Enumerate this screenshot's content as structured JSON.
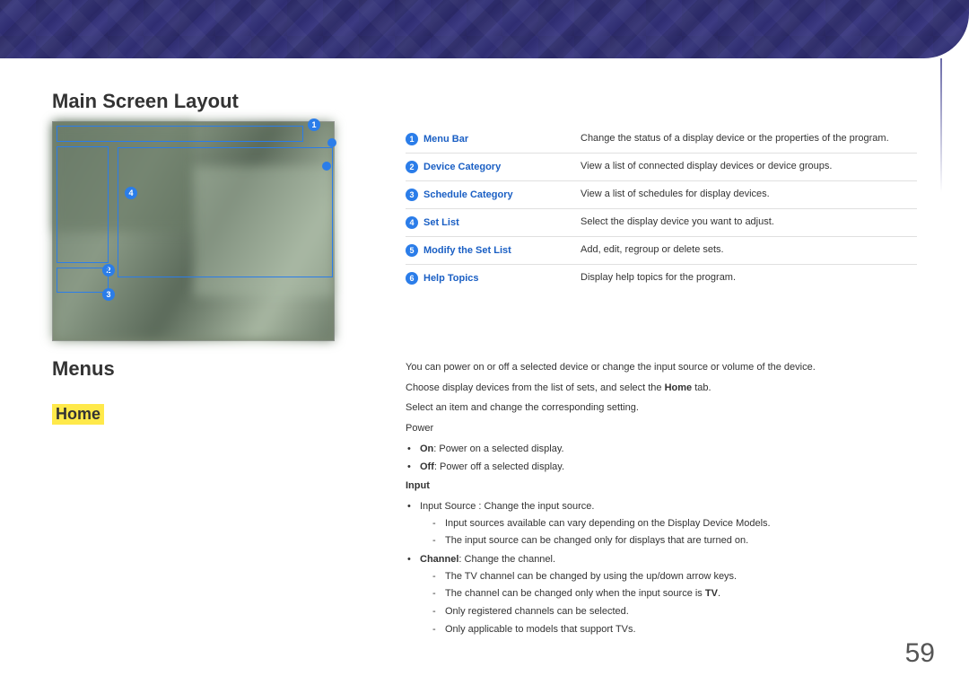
{
  "headings": {
    "main": "Main Screen Layout",
    "menus": "Menus",
    "home": "Home"
  },
  "legend": [
    {
      "num": "1",
      "label": "Menu Bar",
      "desc": "Change the status of a display device or the properties of the program."
    },
    {
      "num": "2",
      "label": "Device Category",
      "desc": "View a list of connected display devices or device groups."
    },
    {
      "num": "3",
      "label": "Schedule Category",
      "desc": "View a list of schedules for display devices."
    },
    {
      "num": "4",
      "label": "Set List",
      "desc": "Select the display device you want to adjust."
    },
    {
      "num": "5",
      "label": "Modify the Set List",
      "desc": "Add, edit, regroup or delete sets."
    },
    {
      "num": "6",
      "label": "Help Topics",
      "desc": "Display help topics for the program."
    }
  ],
  "body": {
    "p1": "You can power on or off a selected device or change the input source or volume of the device.",
    "p2_pre": "Choose display devices from the list of sets, and select the ",
    "p2_bold": "Home",
    "p2_post": " tab.",
    "p3": "Select an item and change the corresponding setting.",
    "power_head": "Power",
    "power_on_bold": "On",
    "power_on_rest": ": Power on a selected display.",
    "power_off_bold": "Off",
    "power_off_rest": ": Power off a selected display.",
    "input_head": "Input",
    "input_src": "Input Source : Change the input source.",
    "input_d1": "Input sources available can vary depending on the Display Device Models.",
    "input_d2": "The input source can be changed only for displays that are turned on.",
    "channel_bold": "Channel",
    "channel_rest": ": Change the channel.",
    "ch_d1": "The TV channel can be changed by using the up/down arrow keys.",
    "ch_d2_pre": "The channel can be changed only when the input source is ",
    "ch_d2_bold": "TV",
    "ch_d2_post": ".",
    "ch_d3": "Only registered channels can be selected.",
    "ch_d4": "Only applicable to models that support TVs."
  },
  "page_number": "59"
}
